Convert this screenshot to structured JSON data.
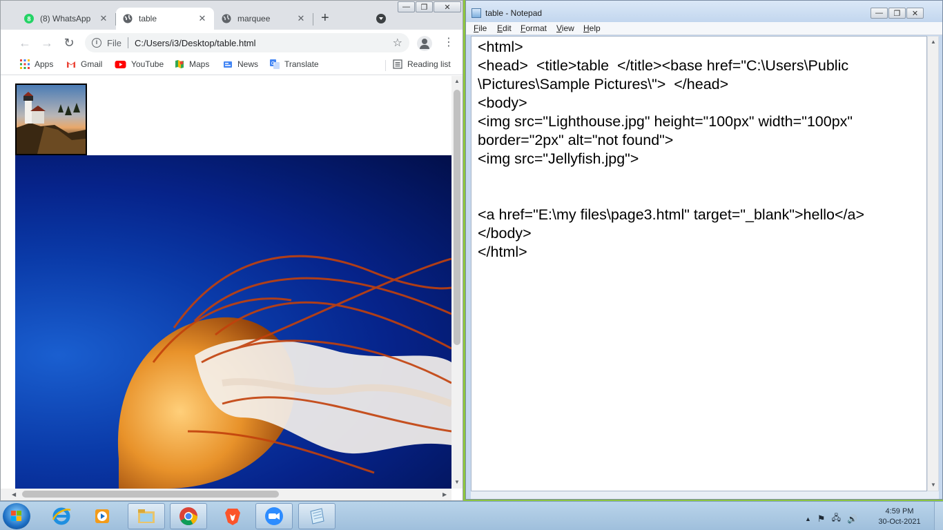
{
  "chrome": {
    "tabs": [
      {
        "title": "(8) WhatsApp",
        "icon": "whatsapp-icon",
        "badge": "8",
        "active": false
      },
      {
        "title": "table",
        "icon": "globe-icon",
        "active": true
      },
      {
        "title": "marquee",
        "icon": "globe-icon",
        "active": false
      }
    ],
    "new_tab_glyph": "+",
    "close_glyph": "✕",
    "toolbar": {
      "back_glyph": "←",
      "forward_glyph": "→",
      "reload_glyph": "↻",
      "info_glyph": "i",
      "scheme": "File",
      "url": "C:/Users/i3/Desktop/table.html",
      "star_glyph": "☆",
      "menu_glyph": "⋮"
    },
    "bookmarks": [
      {
        "label": "Apps",
        "icon": "apps-grid-icon"
      },
      {
        "label": "Gmail",
        "icon": "gmail-icon"
      },
      {
        "label": "YouTube",
        "icon": "youtube-icon"
      },
      {
        "label": "Maps",
        "icon": "maps-icon"
      },
      {
        "label": "News",
        "icon": "news-icon"
      },
      {
        "label": "Translate",
        "icon": "translate-icon"
      }
    ],
    "reading_list": "Reading list",
    "window_buttons": {
      "minimize": "—",
      "restore": "❐",
      "close": "✕"
    }
  },
  "notepad": {
    "title": "table - Notepad",
    "menu": [
      {
        "access": "F",
        "rest": "ile"
      },
      {
        "access": "E",
        "rest": "dit"
      },
      {
        "access": "F",
        "rest": "ormat"
      },
      {
        "access": "V",
        "rest": "iew"
      },
      {
        "access": "H",
        "rest": "elp"
      }
    ],
    "window_buttons": {
      "minimize": "—",
      "restore": "❐",
      "close": "✕"
    },
    "content": "<html>\n<head>  <title>table  </title><base href=\"C:\\Users\\Public\n\\Pictures\\Sample Pictures\\\">  </head>\n<body>\n<img src=\"Lighthouse.jpg\" height=\"100px\" width=\"100px\"\nborder=\"2px\" alt=\"not found\">\n<img src=\"Jellyfish.jpg\">\n\n\n<a href=\"E:\\my files\\page3.html\" target=\"_blank\">hello</a>\n</body>\n</html>"
  },
  "taskbar": {
    "pinned": [
      "internet-explorer-icon",
      "media-player-icon",
      "file-explorer-icon",
      "chrome-icon",
      "brave-icon",
      "zoom-icon",
      "notepad-icon"
    ],
    "tray": {
      "expand_glyph": "▲",
      "flag_glyph": "⚑",
      "network_glyph": "🖧",
      "volume_glyph": "🔊"
    },
    "time": "4:59 PM",
    "date": "30-Oct-2021"
  },
  "colors": {
    "desktop": "#8dc63f",
    "chrome_tabstrip": "#dee1e6",
    "notepad_frame": "#c6d8ee",
    "taskbar": "#b9d4ea"
  }
}
